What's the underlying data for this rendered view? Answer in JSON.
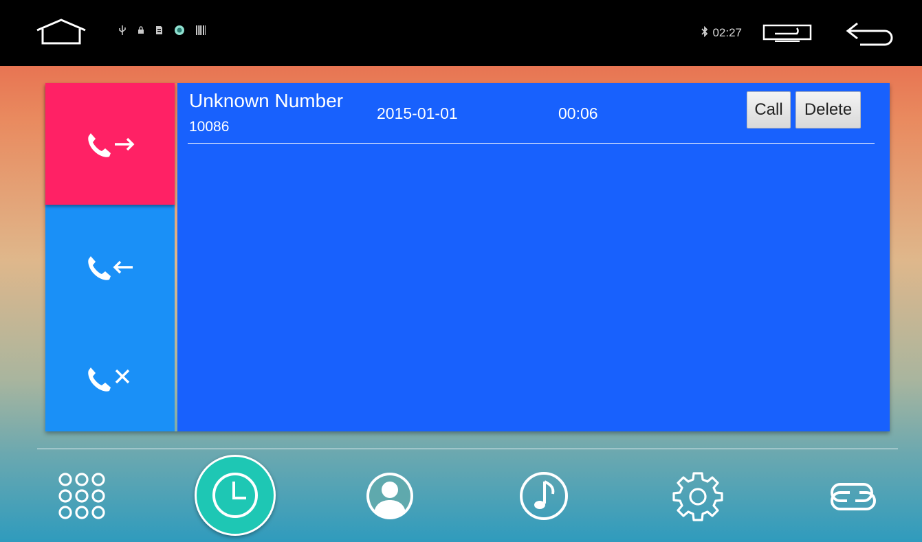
{
  "status_bar": {
    "time": "02:27",
    "icons": [
      "usb-icon",
      "lock-icon",
      "sd-card-icon",
      "android-icon",
      "barcode-icon",
      "bluetooth-icon"
    ],
    "home_icon": "home-icon",
    "window_icon": "window-icon",
    "back_icon": "back-icon"
  },
  "call_tabs": [
    {
      "icon": "outgoing-call-icon",
      "selected": true
    },
    {
      "icon": "incoming-call-icon",
      "selected": false
    },
    {
      "icon": "missed-call-icon",
      "selected": false
    }
  ],
  "call_log": {
    "entries": [
      {
        "name": "Unknown Number",
        "number": "10086",
        "date": "2015-01-01",
        "duration": "00:06",
        "call_label": "Call",
        "delete_label": "Delete"
      }
    ]
  },
  "dock": [
    {
      "icon": "dialpad-icon"
    },
    {
      "icon": "clock-icon",
      "selected": true
    },
    {
      "icon": "contacts-icon"
    },
    {
      "icon": "music-icon"
    },
    {
      "icon": "settings-gear-icon"
    },
    {
      "icon": "link-icon"
    }
  ],
  "colors": {
    "status_bar": "#000000",
    "tab_selected": "#ff2165",
    "tab_background": "#1a90f7",
    "list_background": "#1861fd",
    "dock_selected": "#1ec7b4"
  }
}
